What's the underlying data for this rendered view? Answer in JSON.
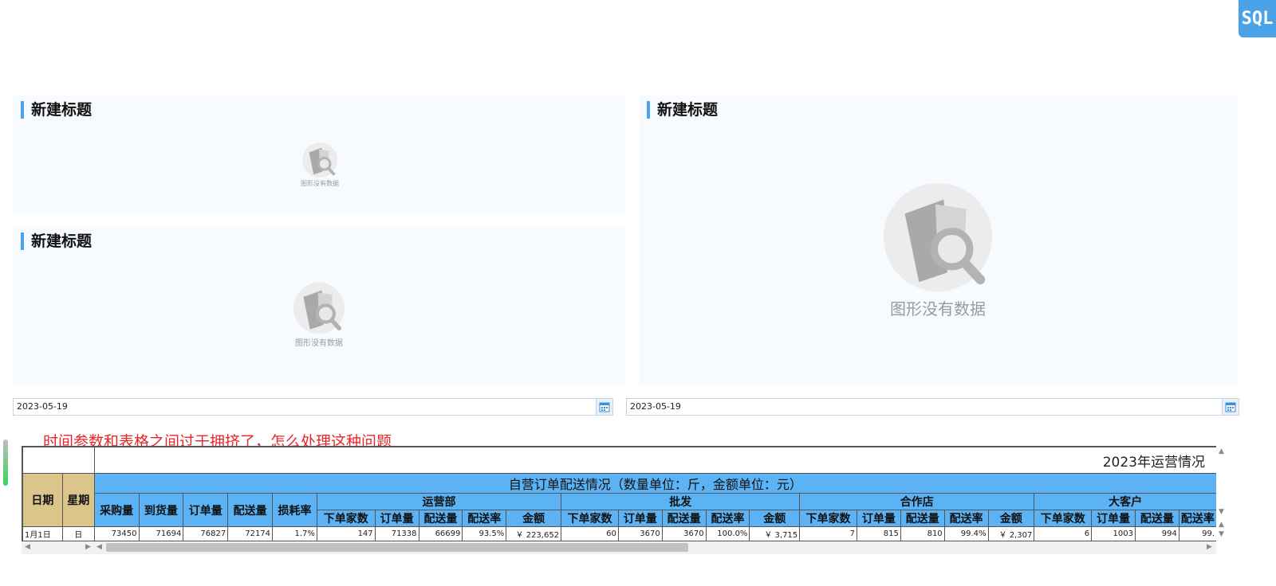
{
  "toolbar": {
    "sql_label": "SQL"
  },
  "panels": [
    {
      "title": "新建标题",
      "no_data": "图形没有数据"
    },
    {
      "title": "新建标题",
      "no_data": "图形没有数据"
    },
    {
      "title": "新建标题",
      "no_data": "图形没有数据"
    }
  ],
  "date_params": [
    {
      "value": "2023-05-19"
    },
    {
      "value": "2023-05-19"
    }
  ],
  "annotation": "时间参数和表格之间过于拥挤了，怎么处理这种问题",
  "report": {
    "caption": "2023年运营情况",
    "banner": "自营订单配送情况（数量单位：斤，金额单位：元）",
    "headers": {
      "date": "日期",
      "weekday": "星期",
      "cols": [
        "采购量",
        "到货量",
        "订单量",
        "配送量",
        "损耗率"
      ],
      "groups": [
        "运营部",
        "批发",
        "合作店",
        "大客户"
      ],
      "sub": [
        "下单家数",
        "订单量",
        "配送量",
        "配送率",
        "金额"
      ]
    },
    "rows": [
      {
        "date": "1月1日",
        "weekday": "日",
        "cols": [
          "73450",
          "71694",
          "76827",
          "72174",
          "1.7%"
        ],
        "groups": [
          [
            "147",
            "71338",
            "66699",
            "93.5%",
            "￥ 223,652"
          ],
          [
            "60",
            "3670",
            "3670",
            "100.0%",
            "￥ 3,715"
          ],
          [
            "7",
            "815",
            "810",
            "99.4%",
            "￥ 2,307"
          ],
          [
            "6",
            "1003",
            "994",
            "99."
          ]
        ]
      }
    ]
  }
}
